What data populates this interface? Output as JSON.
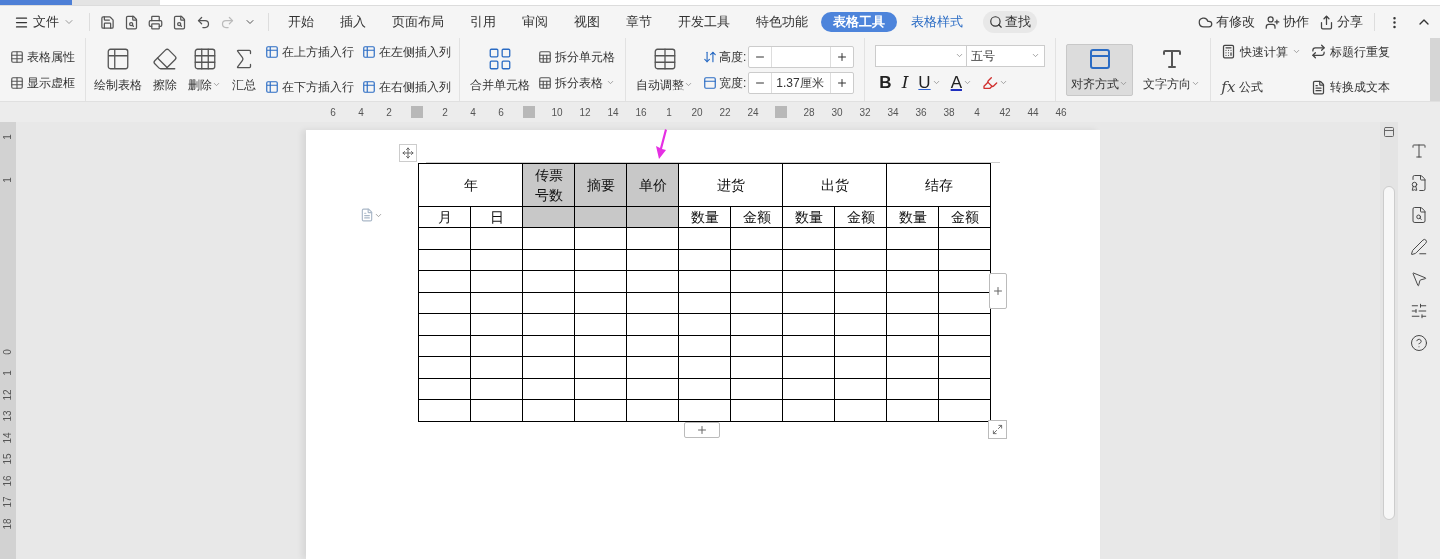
{
  "menu": {
    "file_label": "文件"
  },
  "tabs": [
    {
      "label": "开始",
      "kind": "main",
      "selected": false
    },
    {
      "label": "插入",
      "kind": "main",
      "selected": false
    },
    {
      "label": "页面布局",
      "kind": "main",
      "selected": false
    },
    {
      "label": "引用",
      "kind": "main",
      "selected": false
    },
    {
      "label": "审阅",
      "kind": "main",
      "selected": false
    },
    {
      "label": "视图",
      "kind": "main",
      "selected": false
    },
    {
      "label": "章节",
      "kind": "main",
      "selected": false
    },
    {
      "label": "开发工具",
      "kind": "main",
      "selected": false
    },
    {
      "label": "特色功能",
      "kind": "main",
      "selected": false
    },
    {
      "label": "表格工具",
      "kind": "context",
      "selected": true
    },
    {
      "label": "表格样式",
      "kind": "context",
      "selected": false
    }
  ],
  "search": {
    "label": "查找"
  },
  "actions": [
    {
      "label": "有修改",
      "kind": "cloud"
    },
    {
      "label": "协作",
      "kind": "user"
    },
    {
      "label": "分享",
      "kind": "share"
    }
  ],
  "ribbon": {
    "table_props": [
      {
        "label": "表格属性"
      },
      {
        "label": "显示虚框"
      }
    ],
    "draw_tools": [
      {
        "label": "绘制表格",
        "kind": "draw",
        "dropdown": false
      },
      {
        "label": "擦除",
        "kind": "erase",
        "dropdown": false
      },
      {
        "label": "删除",
        "kind": "delete",
        "dropdown": true
      },
      {
        "label": "汇总",
        "kind": "sum",
        "dropdown": false
      }
    ],
    "insert": [
      {
        "label": "在上方插入行"
      },
      {
        "label": "在下方插入行"
      },
      {
        "label": "在左侧插入列"
      },
      {
        "label": "在右侧插入列"
      }
    ],
    "merge": {
      "label": "合并单元格"
    },
    "split": [
      {
        "label": "拆分单元格",
        "dropdown": false
      },
      {
        "label": "拆分表格",
        "dropdown": true
      }
    ],
    "autofit": {
      "label": "自动调整",
      "dropdown": true
    },
    "height": {
      "label": "高度:"
    },
    "width": {
      "label": "宽度:",
      "value": "1.37厘米"
    },
    "font": {
      "size": "五号"
    },
    "format_buttons": [
      {
        "kind": "bold",
        "label": "B"
      },
      {
        "kind": "italic",
        "label": "I"
      },
      {
        "kind": "underline",
        "label": "U"
      },
      {
        "kind": "font_color",
        "label": "A"
      },
      {
        "kind": "highlight"
      }
    ],
    "align": {
      "label": "对齐方式",
      "selected": true,
      "dropdown": true
    },
    "direction": {
      "label": "文字方向",
      "dropdown": true
    },
    "calc": [
      {
        "label": "快速计算",
        "kind": "calculator",
        "dropdown": true
      },
      {
        "label": "标题行重复",
        "kind": "header_repeat",
        "dropdown": false
      },
      {
        "label": "公式",
        "kind": "formula",
        "glyph": "fx",
        "dropdown": false
      },
      {
        "label": "转换成文本",
        "kind": "convert",
        "dropdown": false
      }
    ]
  },
  "ruler": {
    "ticks": [
      {
        "kind": "number",
        "label": "6"
      },
      {
        "kind": "number",
        "label": "4"
      },
      {
        "kind": "number",
        "label": "2"
      },
      {
        "kind": "marker"
      },
      {
        "kind": "number",
        "label": "2"
      },
      {
        "kind": "number",
        "label": "4"
      },
      {
        "kind": "number",
        "label": "6"
      },
      {
        "kind": "marker"
      },
      {
        "kind": "number",
        "label": "10"
      },
      {
        "kind": "number",
        "label": "12"
      },
      {
        "kind": "number",
        "label": "14"
      },
      {
        "kind": "number",
        "label": "16"
      },
      {
        "kind": "number",
        "label": "1"
      },
      {
        "kind": "number",
        "label": "20"
      },
      {
        "kind": "number",
        "label": "22"
      },
      {
        "kind": "number",
        "label": "24"
      },
      {
        "kind": "marker"
      },
      {
        "kind": "number",
        "label": "28"
      },
      {
        "kind": "number",
        "label": "30"
      },
      {
        "kind": "number",
        "label": "32"
      },
      {
        "kind": "number",
        "label": "34"
      },
      {
        "kind": "number",
        "label": "36"
      },
      {
        "kind": "number",
        "label": "38"
      },
      {
        "kind": "number",
        "label": "4"
      },
      {
        "kind": "number",
        "label": "42"
      },
      {
        "kind": "number",
        "label": "44"
      },
      {
        "kind": "number",
        "label": "46"
      }
    ]
  },
  "vertical_ruler": {
    "ticks": [
      {
        "kind": "number",
        "label": "1"
      },
      {
        "kind": "blank"
      },
      {
        "kind": "number",
        "label": "1"
      },
      {
        "kind": "blank"
      },
      {
        "kind": "blank"
      },
      {
        "kind": "blank"
      },
      {
        "kind": "blank"
      },
      {
        "kind": "blank"
      },
      {
        "kind": "blank"
      },
      {
        "kind": "blank"
      },
      {
        "kind": "number",
        "label": "0"
      },
      {
        "kind": "number",
        "label": "1"
      },
      {
        "kind": "number",
        "label": "12"
      },
      {
        "kind": "number",
        "label": "13"
      },
      {
        "kind": "number",
        "label": "14"
      },
      {
        "kind": "number",
        "label": "15"
      },
      {
        "kind": "number",
        "label": "16"
      },
      {
        "kind": "number",
        "label": "17"
      },
      {
        "kind": "number",
        "label": "18"
      }
    ]
  },
  "table": {
    "columns": [
      {
        "label": "年",
        "subcolumns": [
          "月",
          "日"
        ],
        "selected": false
      },
      {
        "label": "传票号数",
        "selected": true
      },
      {
        "label": "摘要",
        "selected": true
      },
      {
        "label": "单价",
        "selected": true
      },
      {
        "label": "进货",
        "subcolumns": [
          "数量",
          "金额"
        ],
        "selected": false
      },
      {
        "label": "出货",
        "subcolumns": [
          "数量",
          "金额"
        ],
        "selected": false
      },
      {
        "label": "结存",
        "subcolumns": [
          "数量",
          "金额"
        ],
        "selected": false
      }
    ]
  }
}
